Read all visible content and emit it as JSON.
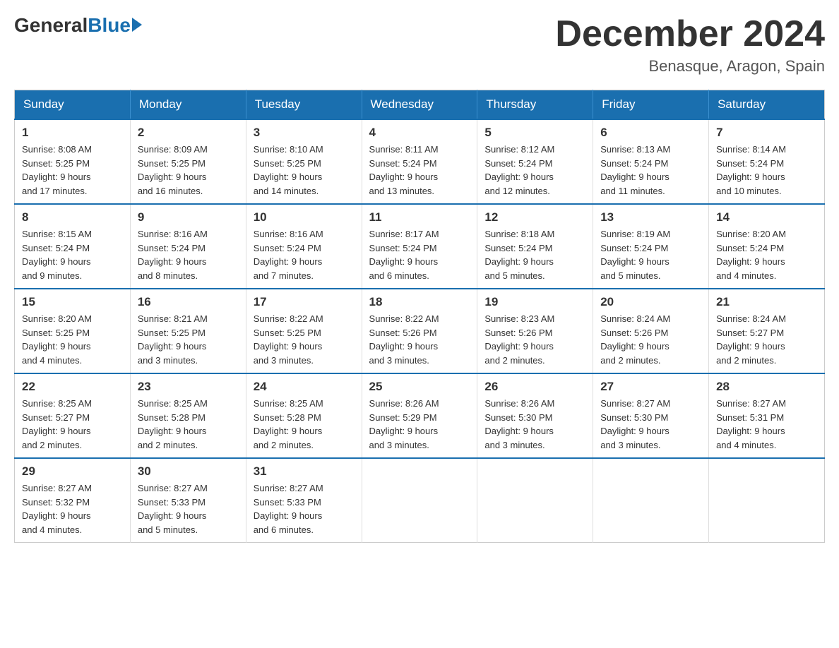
{
  "header": {
    "logo_general": "General",
    "logo_blue": "Blue",
    "month_title": "December 2024",
    "location": "Benasque, Aragon, Spain"
  },
  "days_of_week": [
    "Sunday",
    "Monday",
    "Tuesday",
    "Wednesday",
    "Thursday",
    "Friday",
    "Saturday"
  ],
  "weeks": [
    [
      {
        "day": "1",
        "sunrise": "8:08 AM",
        "sunset": "5:25 PM",
        "daylight": "9 hours and 17 minutes."
      },
      {
        "day": "2",
        "sunrise": "8:09 AM",
        "sunset": "5:25 PM",
        "daylight": "9 hours and 16 minutes."
      },
      {
        "day": "3",
        "sunrise": "8:10 AM",
        "sunset": "5:25 PM",
        "daylight": "9 hours and 14 minutes."
      },
      {
        "day": "4",
        "sunrise": "8:11 AM",
        "sunset": "5:24 PM",
        "daylight": "9 hours and 13 minutes."
      },
      {
        "day": "5",
        "sunrise": "8:12 AM",
        "sunset": "5:24 PM",
        "daylight": "9 hours and 12 minutes."
      },
      {
        "day": "6",
        "sunrise": "8:13 AM",
        "sunset": "5:24 PM",
        "daylight": "9 hours and 11 minutes."
      },
      {
        "day": "7",
        "sunrise": "8:14 AM",
        "sunset": "5:24 PM",
        "daylight": "9 hours and 10 minutes."
      }
    ],
    [
      {
        "day": "8",
        "sunrise": "8:15 AM",
        "sunset": "5:24 PM",
        "daylight": "9 hours and 9 minutes."
      },
      {
        "day": "9",
        "sunrise": "8:16 AM",
        "sunset": "5:24 PM",
        "daylight": "9 hours and 8 minutes."
      },
      {
        "day": "10",
        "sunrise": "8:16 AM",
        "sunset": "5:24 PM",
        "daylight": "9 hours and 7 minutes."
      },
      {
        "day": "11",
        "sunrise": "8:17 AM",
        "sunset": "5:24 PM",
        "daylight": "9 hours and 6 minutes."
      },
      {
        "day": "12",
        "sunrise": "8:18 AM",
        "sunset": "5:24 PM",
        "daylight": "9 hours and 5 minutes."
      },
      {
        "day": "13",
        "sunrise": "8:19 AM",
        "sunset": "5:24 PM",
        "daylight": "9 hours and 5 minutes."
      },
      {
        "day": "14",
        "sunrise": "8:20 AM",
        "sunset": "5:24 PM",
        "daylight": "9 hours and 4 minutes."
      }
    ],
    [
      {
        "day": "15",
        "sunrise": "8:20 AM",
        "sunset": "5:25 PM",
        "daylight": "9 hours and 4 minutes."
      },
      {
        "day": "16",
        "sunrise": "8:21 AM",
        "sunset": "5:25 PM",
        "daylight": "9 hours and 3 minutes."
      },
      {
        "day": "17",
        "sunrise": "8:22 AM",
        "sunset": "5:25 PM",
        "daylight": "9 hours and 3 minutes."
      },
      {
        "day": "18",
        "sunrise": "8:22 AM",
        "sunset": "5:26 PM",
        "daylight": "9 hours and 3 minutes."
      },
      {
        "day": "19",
        "sunrise": "8:23 AM",
        "sunset": "5:26 PM",
        "daylight": "9 hours and 2 minutes."
      },
      {
        "day": "20",
        "sunrise": "8:24 AM",
        "sunset": "5:26 PM",
        "daylight": "9 hours and 2 minutes."
      },
      {
        "day": "21",
        "sunrise": "8:24 AM",
        "sunset": "5:27 PM",
        "daylight": "9 hours and 2 minutes."
      }
    ],
    [
      {
        "day": "22",
        "sunrise": "8:25 AM",
        "sunset": "5:27 PM",
        "daylight": "9 hours and 2 minutes."
      },
      {
        "day": "23",
        "sunrise": "8:25 AM",
        "sunset": "5:28 PM",
        "daylight": "9 hours and 2 minutes."
      },
      {
        "day": "24",
        "sunrise": "8:25 AM",
        "sunset": "5:28 PM",
        "daylight": "9 hours and 2 minutes."
      },
      {
        "day": "25",
        "sunrise": "8:26 AM",
        "sunset": "5:29 PM",
        "daylight": "9 hours and 3 minutes."
      },
      {
        "day": "26",
        "sunrise": "8:26 AM",
        "sunset": "5:30 PM",
        "daylight": "9 hours and 3 minutes."
      },
      {
        "day": "27",
        "sunrise": "8:27 AM",
        "sunset": "5:30 PM",
        "daylight": "9 hours and 3 minutes."
      },
      {
        "day": "28",
        "sunrise": "8:27 AM",
        "sunset": "5:31 PM",
        "daylight": "9 hours and 4 minutes."
      }
    ],
    [
      {
        "day": "29",
        "sunrise": "8:27 AM",
        "sunset": "5:32 PM",
        "daylight": "9 hours and 4 minutes."
      },
      {
        "day": "30",
        "sunrise": "8:27 AM",
        "sunset": "5:33 PM",
        "daylight": "9 hours and 5 minutes."
      },
      {
        "day": "31",
        "sunrise": "8:27 AM",
        "sunset": "5:33 PM",
        "daylight": "9 hours and 6 minutes."
      },
      null,
      null,
      null,
      null
    ]
  ]
}
